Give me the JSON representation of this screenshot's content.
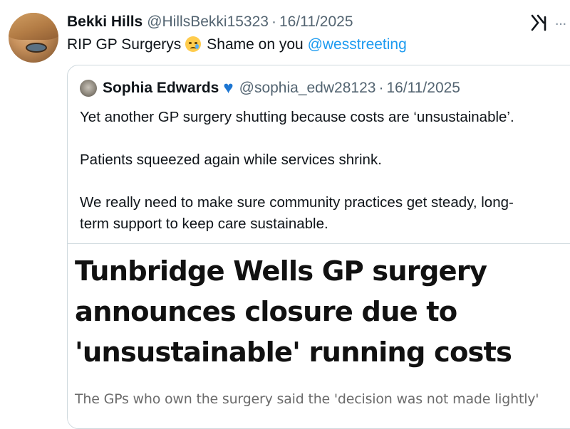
{
  "tweet": {
    "author_name": "Bekki Hills",
    "handle": "@HillsBekki15323",
    "separator": "·",
    "date": "16/11/2025",
    "text_before": "RIP GP Surgerys",
    "emoji": "crying-face",
    "text_after": "Shame on you",
    "mention": "@wesstreeting",
    "platform_icon": "x-logo",
    "more_icon": "more-icon"
  },
  "quote": {
    "author_name": "Sophia Edwards",
    "badge_icon": "blue-heart",
    "handle": "@sophia_edw28123",
    "separator": "·",
    "date": "16/11/2025",
    "lines": [
      "Yet another GP surgery shutting because costs are ‘unsustainable’.",
      "Patients squeezed again while services shrink.",
      "We really need to make sure community practices get steady, long-",
      "term support to keep care sustainable."
    ],
    "media": {
      "headline_lines": [
        "Tunbridge Wells GP surgery",
        "announces closure due to",
        "'unsustainable' running costs"
      ],
      "subheading": "The GPs who own the surgery said the 'decision was not made lightly'"
    }
  },
  "colors": {
    "text": "#0f1419",
    "secondary": "#536471",
    "link": "#1d9bf0",
    "border": "#cfd9de",
    "heart": "#1d76d2"
  }
}
